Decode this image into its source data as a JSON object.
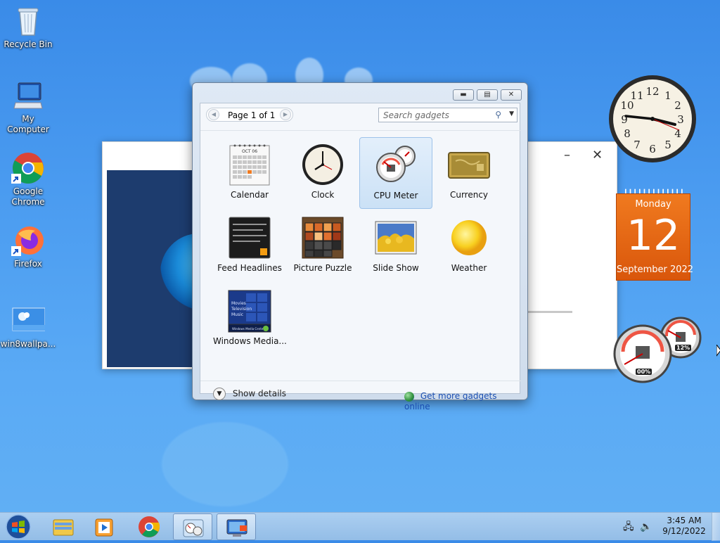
{
  "desktop": {
    "icons": [
      {
        "label": "Recycle Bin"
      },
      {
        "label": "My Computer"
      },
      {
        "label": "Google Chrome"
      },
      {
        "label": "Firefox"
      },
      {
        "label": "win8wallpa..."
      }
    ]
  },
  "gallery": {
    "pager_text": "Page 1 of 1",
    "search_placeholder": "Search gadgets",
    "gadgets": [
      {
        "name": "Calendar",
        "icon": "calendar-thumb",
        "selected": false
      },
      {
        "name": "Clock",
        "icon": "clock-thumb",
        "selected": false
      },
      {
        "name": "CPU Meter",
        "icon": "cpu-meter-thumb",
        "selected": true
      },
      {
        "name": "Currency",
        "icon": "currency-thumb",
        "selected": false
      },
      {
        "name": "Feed Headlines",
        "icon": "feed-thumb",
        "selected": false
      },
      {
        "name": "Picture Puzzle",
        "icon": "puzzle-thumb",
        "selected": false
      },
      {
        "name": "Slide Show",
        "icon": "slideshow-thumb",
        "selected": false
      },
      {
        "name": "Weather",
        "icon": "weather-thumb",
        "selected": false
      },
      {
        "name": "Windows Media...",
        "icon": "media-center-thumb",
        "selected": false
      }
    ],
    "show_details": "Show details",
    "get_more": "Get more gadgets online",
    "calendar_thumb_month": "OCT 06",
    "media_thumb_lines": [
      "Movies",
      "Television",
      "Music"
    ],
    "media_thumb_brand": "Windows Media Center"
  },
  "calendar_gadget": {
    "weekday": "Monday",
    "day": "12",
    "month_year": "September 2022"
  },
  "clock_gadget": {
    "numbers": [
      "12",
      "1",
      "2",
      "3",
      "4",
      "5",
      "6",
      "7",
      "8",
      "9",
      "10",
      "11"
    ],
    "time": "3:45"
  },
  "cpu_gadget": {
    "cpu_percent": "00%",
    "memory_percent": "12%"
  },
  "taskbar": {
    "time": "3:45 AM",
    "date": "9/12/2022",
    "apps": [
      "explorer-icon",
      "media-player-icon",
      "chrome-icon",
      "gadgets-icon",
      "remote-desktop-icon"
    ]
  },
  "colors": {
    "accent": "#1b4eb0",
    "calendar_orange": "#e8651a",
    "desktop_blue": "#4a9bf0"
  }
}
